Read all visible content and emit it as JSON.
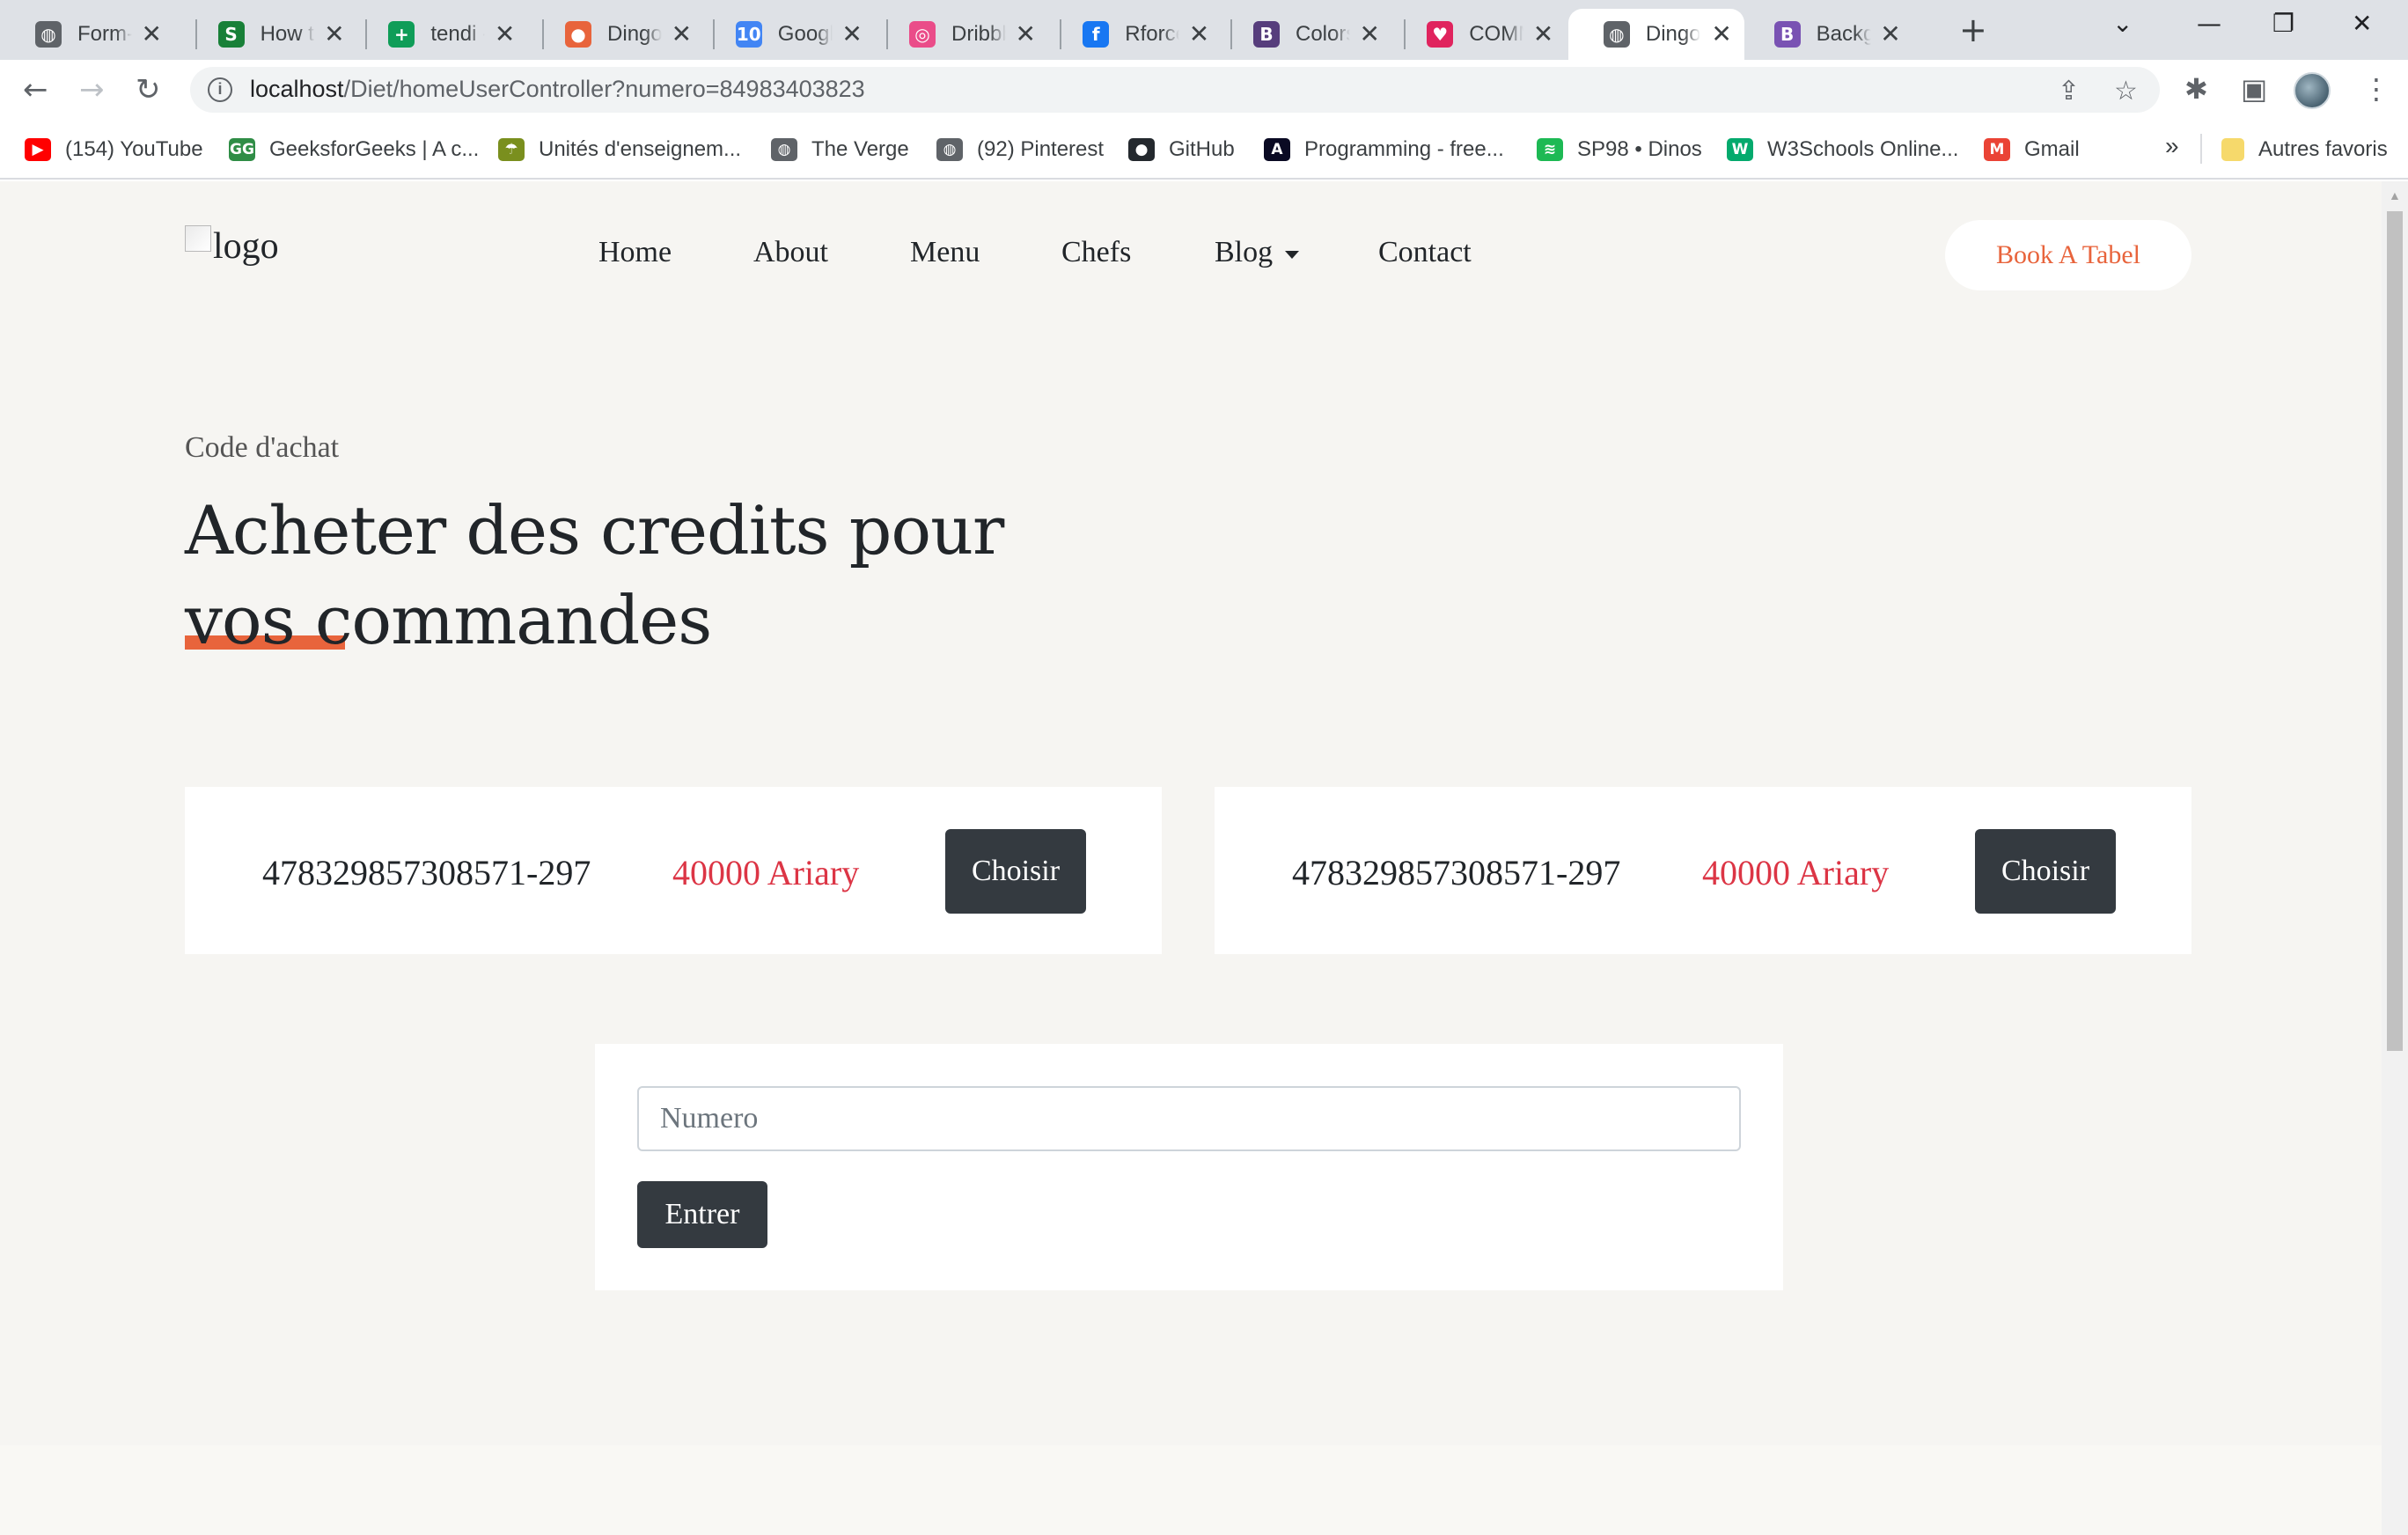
{
  "browser": {
    "tabs": [
      {
        "title": "Form-U",
        "icon": "globe-icon",
        "color": "#5f6368",
        "glyph": "◍"
      },
      {
        "title": "How to",
        "icon": "sheets-s-icon",
        "color": "#188038",
        "glyph": "S"
      },
      {
        "title": "tendi -",
        "icon": "sheets-icon",
        "color": "#0f9d58",
        "glyph": "+"
      },
      {
        "title": "Dingo",
        "icon": "mushroom-icon",
        "color": "#e8643c",
        "glyph": "●"
      },
      {
        "title": "Google",
        "icon": "calendar-icon",
        "color": "#4285f4",
        "glyph": "10"
      },
      {
        "title": "Dribbb",
        "icon": "dribbble-icon",
        "color": "#ea4c89",
        "glyph": "◎"
      },
      {
        "title": "Rforce",
        "icon": "facebook-icon",
        "color": "#1877f2",
        "glyph": "f"
      },
      {
        "title": "Colors",
        "icon": "bootstrap-icon",
        "color": "#563d7c",
        "glyph": "B"
      },
      {
        "title": "COMM",
        "icon": "heart-icon",
        "color": "#e0245e",
        "glyph": "♥"
      },
      {
        "title": "Dingo",
        "icon": "globe-icon",
        "color": "#5f6368",
        "glyph": "◍",
        "active": true
      },
      {
        "title": "Backgr",
        "icon": "bootstrap-icon",
        "color": "#7952b3",
        "glyph": "B"
      }
    ],
    "url_host": "localhost",
    "url_path": "/Diet/homeUserController?numero=84983403823",
    "bookmarks": [
      {
        "label": "(154) YouTube",
        "icon": "youtube-icon",
        "color": "#ff0000",
        "glyph": "▶"
      },
      {
        "label": "GeeksforGeeks | A c...",
        "icon": "geeksforgeeks-icon",
        "color": "#2f8d46",
        "glyph": "GG"
      },
      {
        "label": "Unités d'enseignem...",
        "icon": "umbrella-icon",
        "color": "#7a8f1e",
        "glyph": "☂"
      },
      {
        "label": "The Verge",
        "icon": "globe-icon",
        "color": "#5f6368",
        "glyph": "◍"
      },
      {
        "label": "(92) Pinterest",
        "icon": "globe-icon",
        "color": "#5f6368",
        "glyph": "◍"
      },
      {
        "label": "GitHub",
        "icon": "github-icon",
        "color": "#24292e",
        "glyph": "●"
      },
      {
        "label": "Programming - free...",
        "icon": "freecodecamp-icon",
        "color": "#0a0a23",
        "glyph": "A"
      },
      {
        "label": "SP98 • Dinos",
        "icon": "spotify-icon",
        "color": "#1db954",
        "glyph": "≋"
      },
      {
        "label": "W3Schools Online...",
        "icon": "w3schools-icon",
        "color": "#04aa6d",
        "glyph": "W"
      },
      {
        "label": "Gmail",
        "icon": "gmail-icon",
        "color": "#ea4335",
        "glyph": "M"
      }
    ],
    "bookmarks_more": "»",
    "other_bookmarks": "Autres favoris"
  },
  "site": {
    "logo_alt": "logo",
    "nav": [
      "Home",
      "About",
      "Menu",
      "Chefs",
      "Blog",
      "Contact"
    ],
    "book_button": "Book A Tabel",
    "eyebrow": "Code d'achat",
    "heading_line1": "Acheter des credits pour",
    "heading_line2": "vos commandes",
    "accent_color": "#e8643c"
  },
  "offers": [
    {
      "code": "478329857308571-297",
      "price": "40000 Ariary",
      "button": "Choisir"
    },
    {
      "code": "478329857308571-297",
      "price": "40000 Ariary",
      "button": "Choisir"
    }
  ],
  "form": {
    "placeholder": "Numero",
    "submit": "Entrer"
  }
}
